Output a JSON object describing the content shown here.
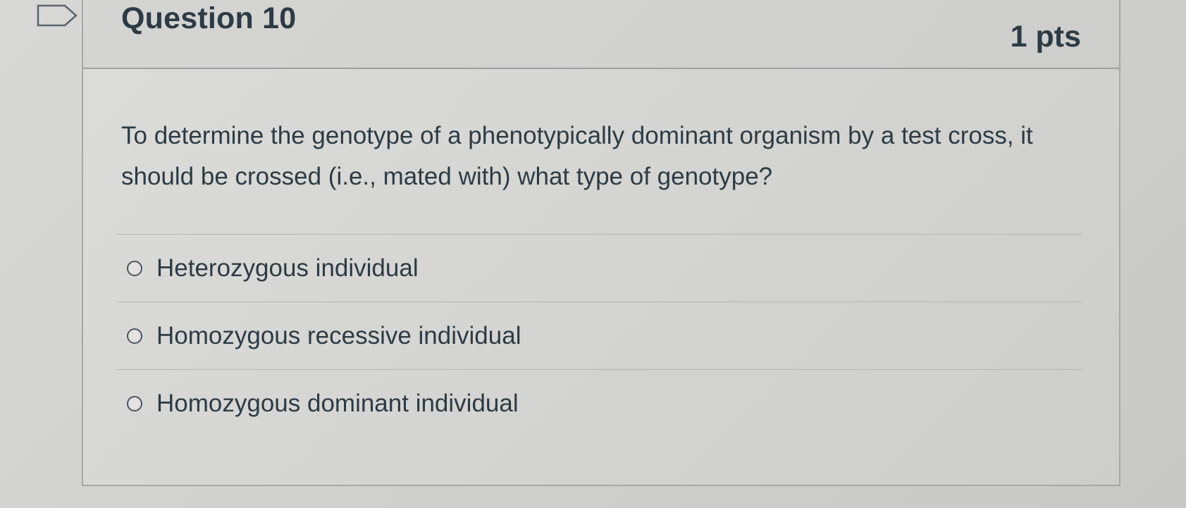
{
  "question": {
    "title": "Question 10",
    "points": "1 pts",
    "text": "To determine the genotype of a phenotypically dominant organism by a test cross, it should be crossed (i.e., mated with) what type of genotype?"
  },
  "answers": [
    {
      "label": "Heterozygous individual",
      "selected": false
    },
    {
      "label": "Homozygous recessive individual",
      "selected": false
    },
    {
      "label": "Homozygous dominant individual",
      "selected": false
    }
  ],
  "icons": {
    "flag": "flag-question-icon"
  },
  "colors": {
    "text": "#2d3b45",
    "background": "#d4d4d2",
    "border": "#a8a8a6"
  }
}
